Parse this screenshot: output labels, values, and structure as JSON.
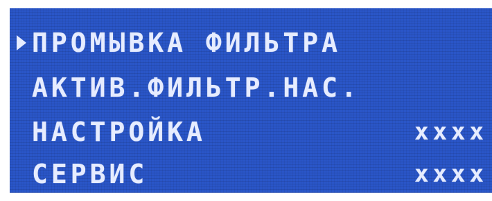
{
  "display": {
    "background_color": "#2a56c8",
    "text_color": "#e6ecff",
    "cursor_icon": "triangle-right-icon",
    "items": [
      {
        "label": "ПРОМЫВКА ФИЛЬТРА",
        "value": "",
        "selected": true
      },
      {
        "label": "АКТИВ.ФИЛЬТР.НАС.",
        "value": "",
        "selected": false
      },
      {
        "label": "НАСТРОЙКА",
        "value": "xxxx",
        "selected": false
      },
      {
        "label": "СЕРВИС",
        "value": "xxxx",
        "selected": false
      }
    ]
  }
}
